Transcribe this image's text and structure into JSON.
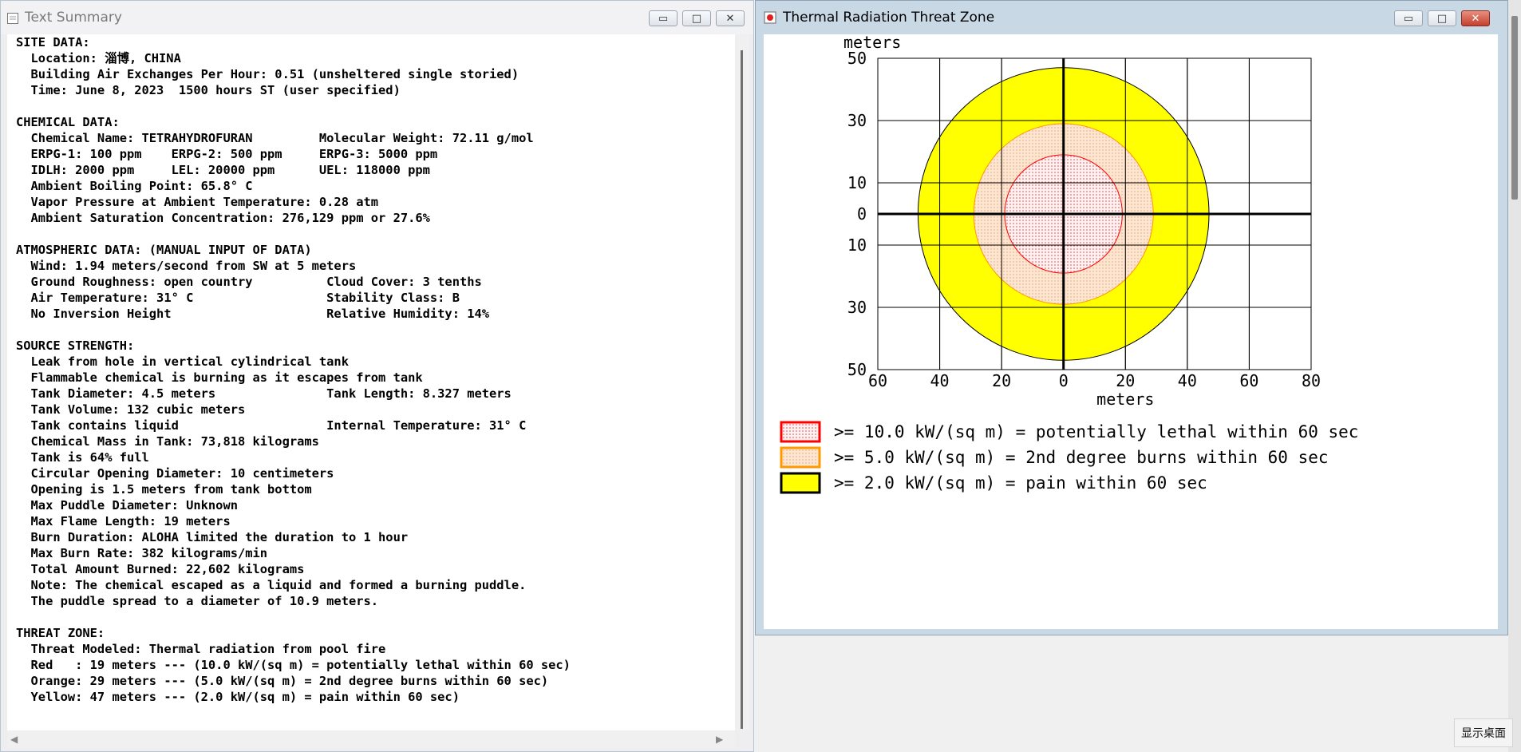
{
  "text_window": {
    "title": "Text Summary",
    "lines": [
      "SITE DATA:",
      "  Location: 淄博, CHINA",
      "  Building Air Exchanges Per Hour: 0.51 (unsheltered single storied)",
      "  Time: June 8, 2023  1500 hours ST (user specified)",
      "",
      "CHEMICAL DATA:",
      "  Chemical Name: TETRAHYDROFURAN         Molecular Weight: 72.11 g/mol",
      "  ERPG-1: 100 ppm    ERPG-2: 500 ppm     ERPG-3: 5000 ppm",
      "  IDLH: 2000 ppm     LEL: 20000 ppm      UEL: 118000 ppm",
      "  Ambient Boiling Point: 65.8° C",
      "  Vapor Pressure at Ambient Temperature: 0.28 atm",
      "  Ambient Saturation Concentration: 276,129 ppm or 27.6%",
      "",
      "ATMOSPHERIC DATA: (MANUAL INPUT OF DATA)",
      "  Wind: 1.94 meters/second from SW at 5 meters",
      "  Ground Roughness: open country          Cloud Cover: 3 tenths",
      "  Air Temperature: 31° C                  Stability Class: B",
      "  No Inversion Height                     Relative Humidity: 14%",
      "",
      "SOURCE STRENGTH:",
      "  Leak from hole in vertical cylindrical tank",
      "  Flammable chemical is burning as it escapes from tank",
      "  Tank Diameter: 4.5 meters               Tank Length: 8.327 meters",
      "  Tank Volume: 132 cubic meters",
      "  Tank contains liquid                    Internal Temperature: 31° C",
      "  Chemical Mass in Tank: 73,818 kilograms",
      "  Tank is 64% full",
      "  Circular Opening Diameter: 10 centimeters",
      "  Opening is 1.5 meters from tank bottom",
      "  Max Puddle Diameter: Unknown",
      "  Max Flame Length: 19 meters",
      "  Burn Duration: ALOHA limited the duration to 1 hour",
      "  Max Burn Rate: 382 kilograms/min",
      "  Total Amount Burned: 22,602 kilograms",
      "  Note: The chemical escaped as a liquid and formed a burning puddle.",
      "  The puddle spread to a diameter of 10.9 meters.",
      "",
      "THREAT ZONE:",
      "  Threat Modeled: Thermal radiation from pool fire",
      "  Red   : 19 meters --- (10.0 kW/(sq m) = potentially lethal within 60 sec)",
      "  Orange: 29 meters --- (5.0 kW/(sq m) = 2nd degree burns within 60 sec)",
      "  Yellow: 47 meters --- (2.0 kW/(sq m) = pain within 60 sec)"
    ]
  },
  "chart_window": {
    "title": "Thermal Radiation Threat Zone"
  },
  "chart_data": {
    "type": "scatter",
    "title": "",
    "xlabel": "meters",
    "ylabel": "meters",
    "xlim": [
      -60,
      80
    ],
    "ylim": [
      -50,
      50
    ],
    "x_ticks": [
      -60,
      -40,
      -20,
      0,
      20,
      40,
      60,
      80
    ],
    "x_tick_labels": [
      "60",
      "40",
      "20",
      "0",
      "20",
      "40",
      "60",
      "80"
    ],
    "y_ticks": [
      50,
      30,
      10,
      0,
      -10,
      -30,
      -50
    ],
    "y_tick_labels": [
      "50",
      "30",
      "10",
      "0",
      "10",
      "30",
      "50"
    ],
    "grid": true,
    "zones": [
      {
        "name": "Yellow",
        "radius": 47,
        "fill": "#ffff00",
        "border": "#000000"
      },
      {
        "name": "Orange",
        "radius": 29,
        "fill": "#fde2c8",
        "border": "#ff9900"
      },
      {
        "name": "Red",
        "radius": 19,
        "fill": "#fde8e8",
        "border": "#ff0000"
      }
    ],
    "legend": [
      {
        "label": ">= 10.0 kW/(sq m) = potentially lethal within 60 sec",
        "fill": "#fde8e8",
        "border": "#ff0000"
      },
      {
        "label": ">= 5.0 kW/(sq m) = 2nd degree burns within 60 sec",
        "fill": "#fde2c8",
        "border": "#ff9900"
      },
      {
        "label": ">= 2.0 kW/(sq m) = pain within 60 sec",
        "fill": "#ffff00",
        "border": "#000000"
      }
    ]
  },
  "taskbar": {
    "show_desktop": "显示桌面"
  }
}
